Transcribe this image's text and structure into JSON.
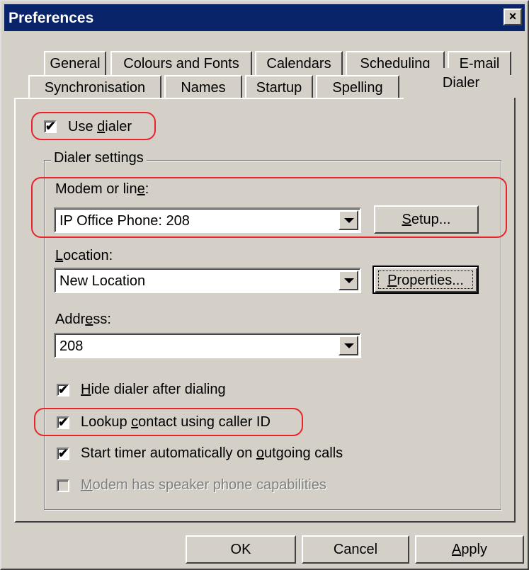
{
  "window": {
    "title": "Preferences",
    "close_label": "×"
  },
  "tabs_row1": [
    {
      "label": "General"
    },
    {
      "label": "Colours and Fonts"
    },
    {
      "label": "Calendars"
    },
    {
      "label": "Scheduling"
    },
    {
      "label": "E-mail"
    }
  ],
  "tabs_row2": [
    {
      "label": "Synchronisation"
    },
    {
      "label": "Names"
    },
    {
      "label": "Startup"
    },
    {
      "label": "Spelling"
    },
    {
      "label": "Dialer",
      "active": true
    }
  ],
  "use_dialer": {
    "pre": "Use ",
    "accel": "d",
    "post": "ialer",
    "checked": true
  },
  "dialer_settings": {
    "legend": "Dialer settings",
    "modem": {
      "pre": "Modem or lin",
      "accel": "e",
      "post": ":",
      "value": "IP Office Phone: 208"
    },
    "setup_button": {
      "accel": "S",
      "post": "etup..."
    },
    "location": {
      "accel": "L",
      "post": "ocation:",
      "value": "New Location"
    },
    "properties_button": {
      "accel": "P",
      "post": "roperties..."
    },
    "address": {
      "pre": "Addr",
      "accel": "e",
      "post": "ss:",
      "value": "208"
    },
    "options": [
      {
        "pre": "",
        "accel": "H",
        "post": "ide dialer after dialing",
        "checked": true,
        "enabled": true
      },
      {
        "pre": "Lookup ",
        "accel": "c",
        "post": "ontact using caller ID",
        "checked": true,
        "enabled": true
      },
      {
        "pre": "Start timer automatically on ",
        "accel": "o",
        "post": "utgoing calls",
        "checked": true,
        "enabled": true
      },
      {
        "pre": "",
        "accel": "M",
        "post": "odem has speaker phone capabilities",
        "checked": false,
        "enabled": false
      }
    ]
  },
  "buttons": {
    "ok": "OK",
    "cancel": "Cancel",
    "apply": {
      "accel": "A",
      "post": "pply"
    }
  },
  "checkmark": "✔",
  "highlight_color": "#e8232a"
}
